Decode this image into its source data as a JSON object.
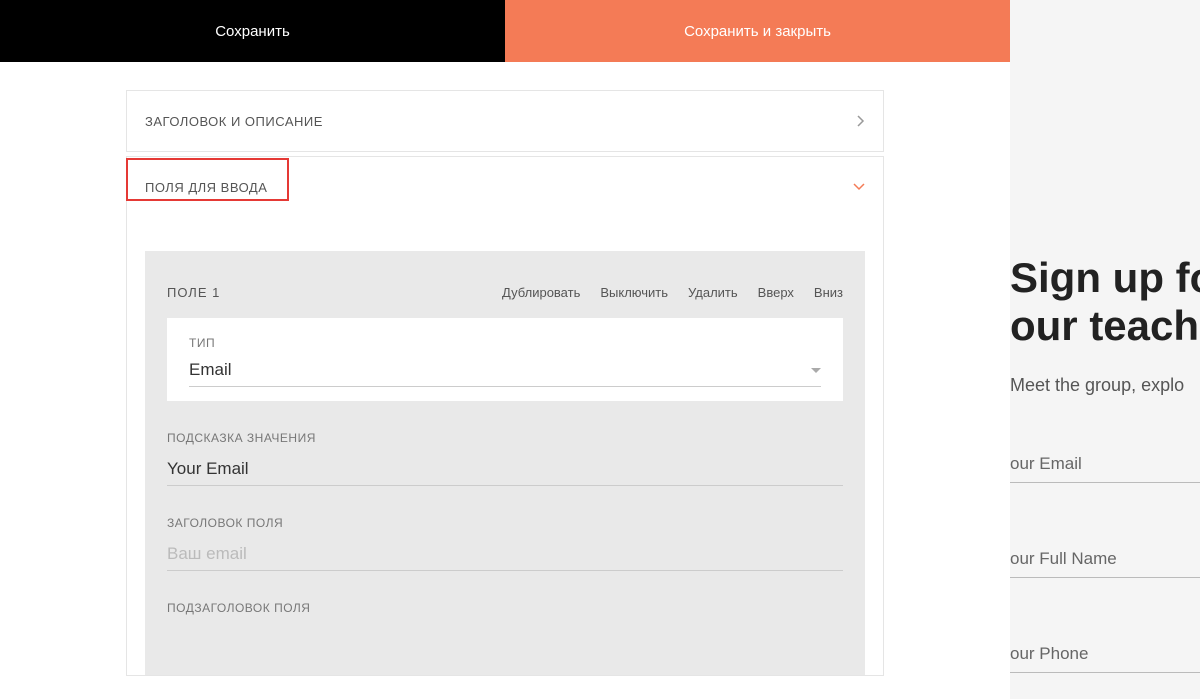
{
  "topbar": {
    "save": "Сохранить",
    "save_close": "Сохранить и закрыть"
  },
  "panels": {
    "title_desc": "ЗАГОЛОВОК И ОПИСАНИЕ",
    "input_fields": "ПОЛЯ ДЛЯ ВВОДА"
  },
  "field1": {
    "name": "ПОЛЕ 1",
    "actions": {
      "duplicate": "Дублировать",
      "disable": "Выключить",
      "delete": "Удалить",
      "up": "Вверх",
      "down": "Вниз"
    },
    "type_label": "ТИП",
    "type_value": "Email",
    "hint_label": "ПОДСКАЗКА ЗНАЧЕНИЯ",
    "hint_value": "Your Email",
    "title_label": "ЗАГОЛОВОК ПОЛЯ",
    "title_placeholder": "Ваш email",
    "subtitle_label": "ПОДЗАГОЛОВОК ПОЛЯ"
  },
  "preview": {
    "heading1": "Sign up fo",
    "heading2": "our teache",
    "sub": "Meet the group, explo",
    "fields": [
      "our Email",
      "our Full Name",
      "our Phone"
    ]
  }
}
